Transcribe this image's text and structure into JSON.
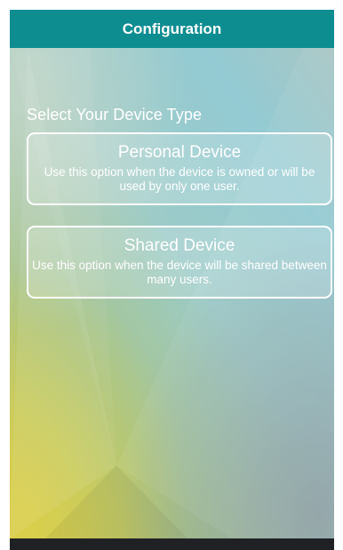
{
  "header": {
    "title": "Configuration"
  },
  "main": {
    "section_title": "Select Your Device Type",
    "options": [
      {
        "title": "Personal Device",
        "description": "Use this option when the device is owned or will be used by only one user."
      },
      {
        "title": "Shared Device",
        "description": "Use this option when the device will be shared between many users."
      }
    ]
  },
  "colors": {
    "header": "#0e8d91",
    "navbar": "#202124",
    "text": "#ffffff"
  }
}
